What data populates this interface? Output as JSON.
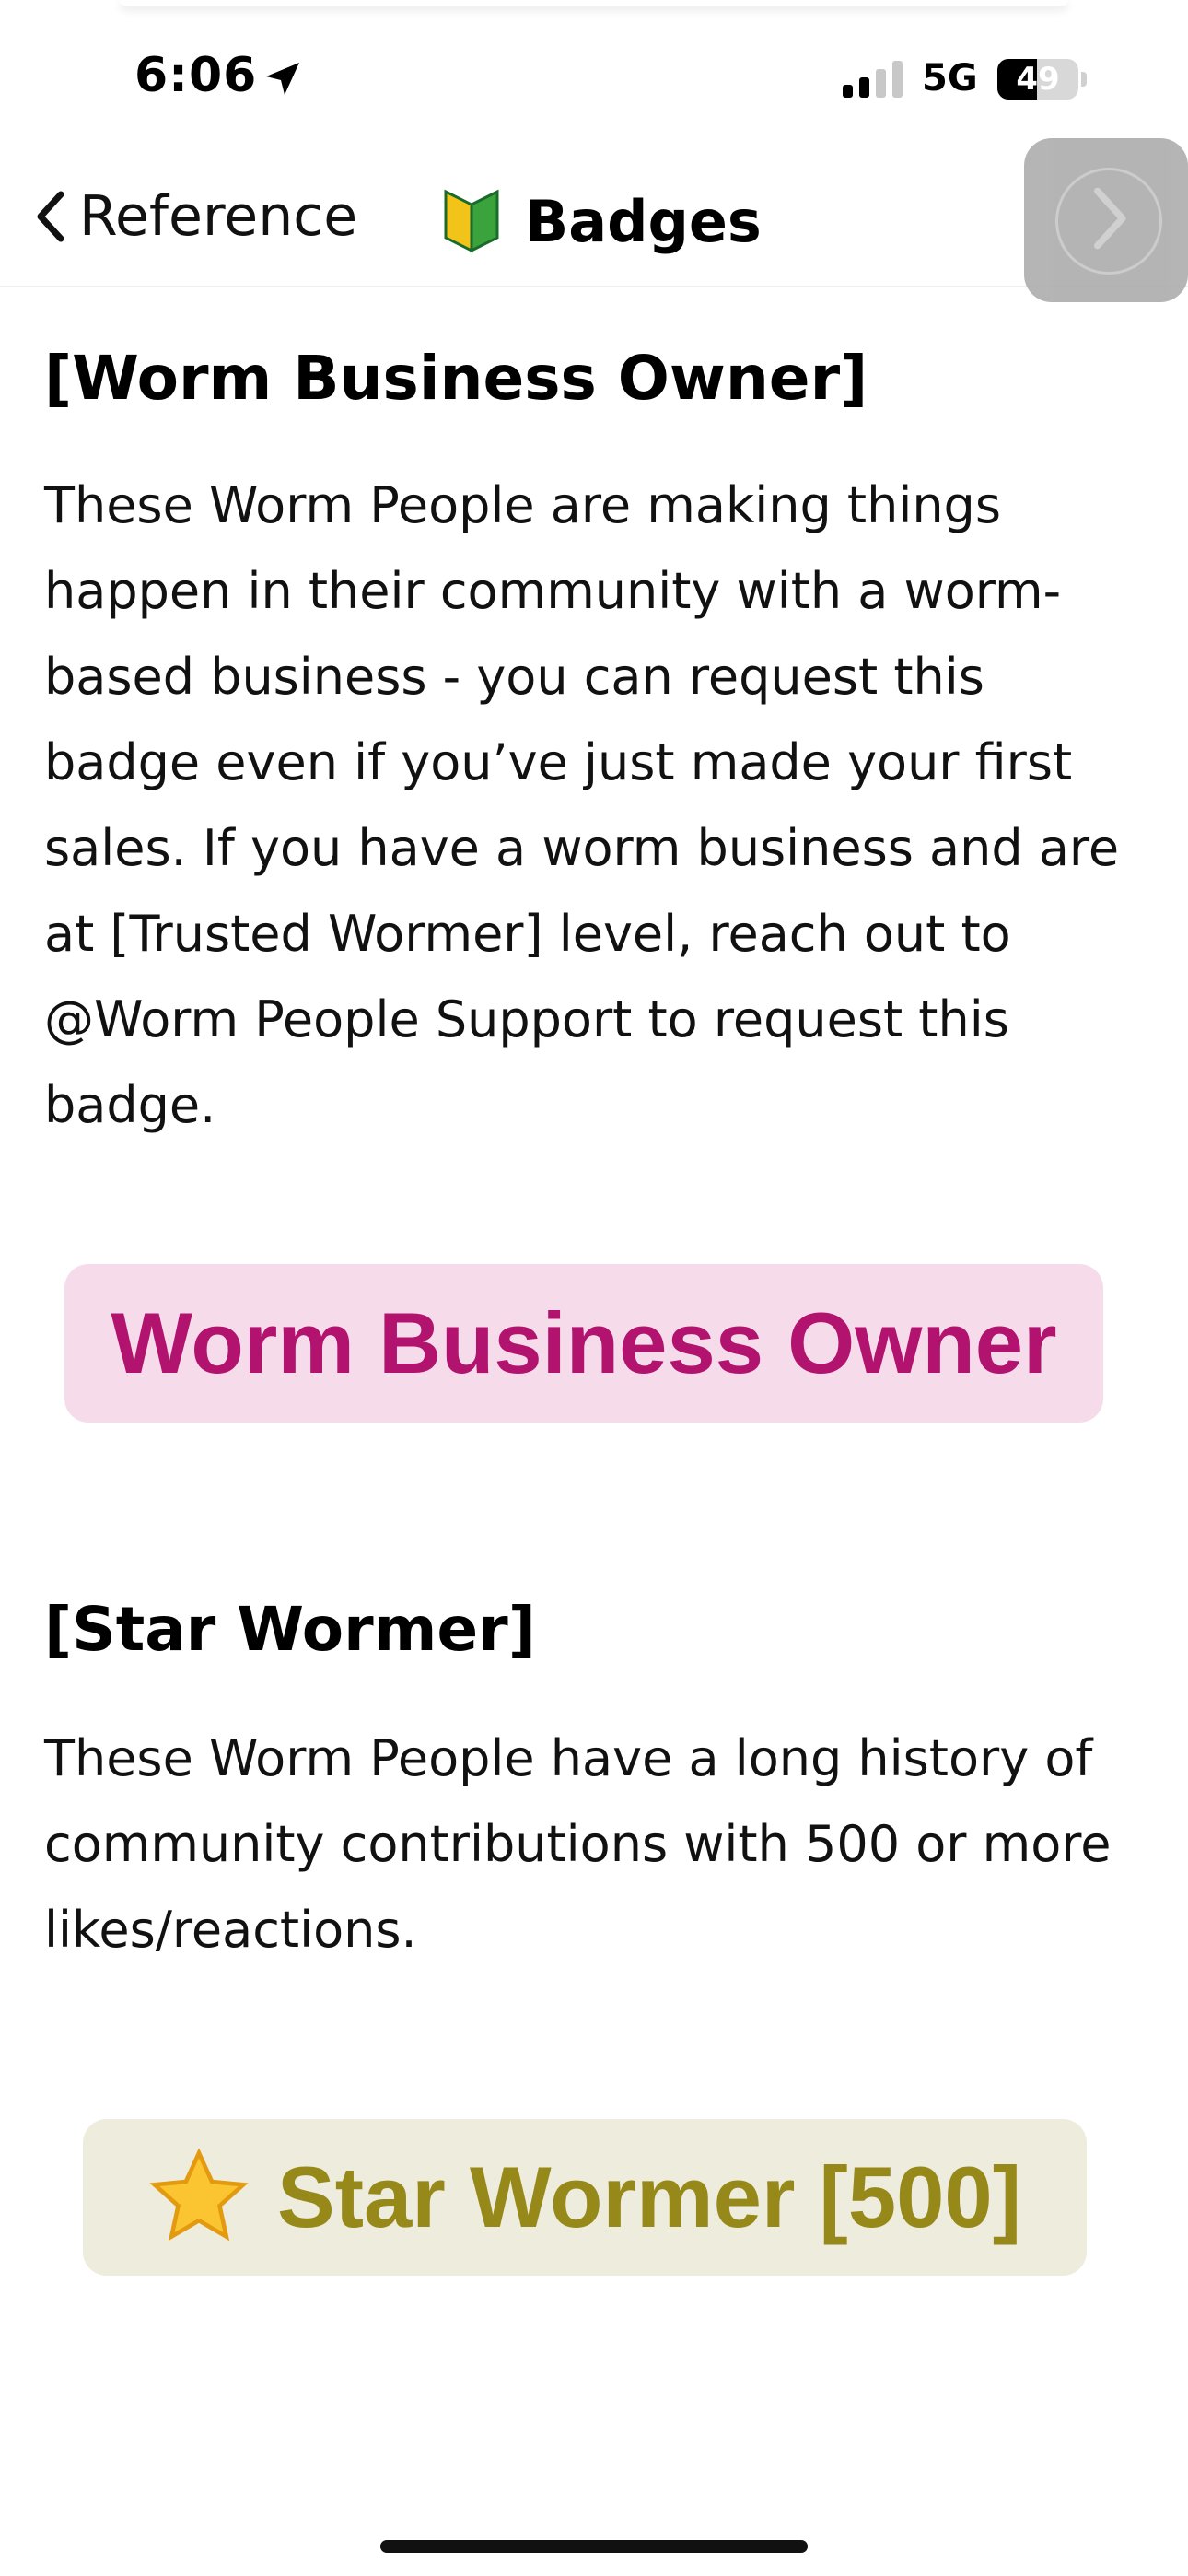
{
  "status_bar": {
    "time": "6:06",
    "network": "5G",
    "battery_percent": "49",
    "battery_level": 0.49
  },
  "nav": {
    "back_label": "Reference",
    "title": "Badges",
    "title_icon": "beginner-leaf-icon",
    "next_icon": "chevron-right-icon"
  },
  "sections": [
    {
      "heading": "[Worm Business Owner]",
      "lines": [
        "These Worm People are making things",
        "happen in their community with a worm-",
        "based business - you can request this",
        "badge even if you’ve just made your first",
        "sales.  If you have a worm business and are",
        "at [Trusted Wormer] level, reach out to",
        "@Worm People Support to request this",
        "badge."
      ],
      "badge_label": "Worm Business Owner",
      "badge_colors": {
        "background": "#f6dcea",
        "text": "#b2136f"
      }
    },
    {
      "heading": "[Star Wormer]",
      "lines": [
        "These Worm People have a long history of",
        "community contributions with 500 or more",
        "likes/reactions."
      ],
      "badge_label": "Star Wormer [500]",
      "badge_icon": "star-icon",
      "badge_colors": {
        "background": "#eeecdd",
        "text": "#96891a"
      }
    }
  ]
}
